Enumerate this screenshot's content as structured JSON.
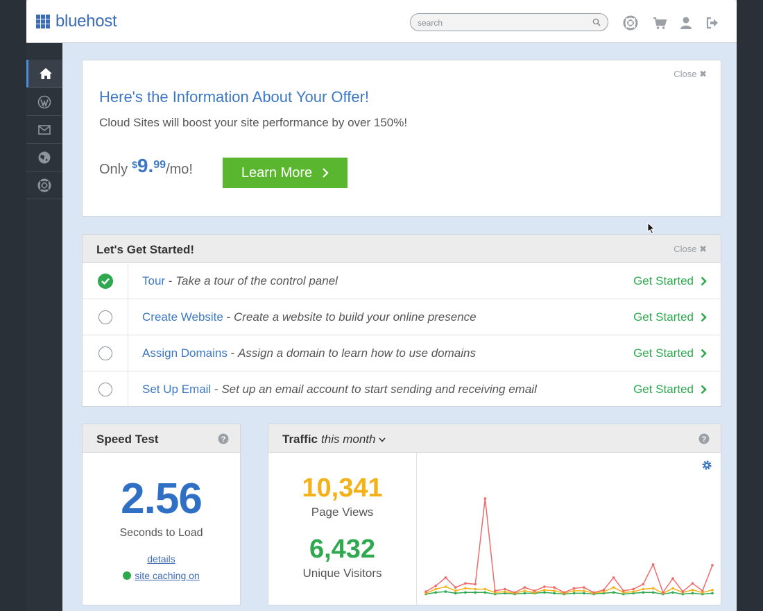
{
  "brand": {
    "name": "bluehost",
    "color": "#3d6ab7"
  },
  "search": {
    "placeholder": "search",
    "value": ""
  },
  "topbar_icons": [
    "help-lifebuoy-icon",
    "cart-icon",
    "user-icon",
    "logout-icon"
  ],
  "sidebar": {
    "items": [
      {
        "icon": "home-icon",
        "active": true
      },
      {
        "icon": "wordpress-icon",
        "active": false
      },
      {
        "icon": "mail-icon",
        "active": false
      },
      {
        "icon": "globe-icon",
        "active": false
      },
      {
        "icon": "support-lifebuoy-icon",
        "active": false
      }
    ]
  },
  "offer": {
    "close_label": "Close",
    "title": "Here's the Information About Your Offer!",
    "subtitle": "Cloud Sites will boost your site performance by over 150%!",
    "price_prefix": "Only",
    "currency": "$",
    "price_dollars": "9.",
    "price_cents": "99",
    "price_suffix": "/mo!",
    "cta_label": "Learn More",
    "cta_color": "#5bb62f"
  },
  "getting_started": {
    "title": "Let's Get Started!",
    "close_label": "Close",
    "tasks": [
      {
        "name": "Tour",
        "separator": " - ",
        "description": "Take a tour of the control panel",
        "done": true,
        "action": "Get Started"
      },
      {
        "name": "Create Website",
        "separator": " - ",
        "description": "Create a website to build your online presence",
        "done": false,
        "action": "Get Started"
      },
      {
        "name": "Assign Domains",
        "separator": " - ",
        "description": "Assign a domain to learn how to use domains",
        "done": false,
        "action": "Get Started"
      },
      {
        "name": "Set Up Email",
        "separator": " - ",
        "description": "Set up an email account to start sending and receiving email",
        "done": false,
        "action": "Get Started"
      }
    ]
  },
  "speed_test": {
    "title": "Speed Test",
    "value": "2.56",
    "label": "Seconds to Load",
    "details_link": "details",
    "caching_link": "site caching on",
    "caching_status_color": "#2fa84f"
  },
  "traffic": {
    "title": "Traffic",
    "period": "this month",
    "page_views": "10,341",
    "page_views_label": "Page Views",
    "page_views_color": "#f3b21a",
    "unique_visitors": "6,432",
    "unique_visitors_label": "Unique Visitors",
    "unique_visitors_color": "#2fa84f"
  },
  "chart_data": {
    "type": "line",
    "x": [
      1,
      2,
      3,
      4,
      5,
      6,
      7,
      8,
      9,
      10,
      11,
      12,
      13,
      14,
      15,
      16,
      17,
      18,
      19,
      20,
      21,
      22,
      23,
      24,
      25,
      26,
      27,
      28,
      29,
      30
    ],
    "series": [
      {
        "color": "#ef6b6b",
        "values": [
          0.5,
          1.2,
          2.2,
          1.0,
          1.5,
          1.4,
          11.8,
          0.6,
          0.8,
          0.4,
          1.0,
          0.6,
          1.1,
          1.0,
          0.4,
          0.9,
          1.0,
          0.4,
          0.7,
          2.2,
          0.6,
          0.8,
          1.4,
          3.8,
          0.4,
          2.1,
          0.5,
          1.5,
          0.6,
          3.7
        ]
      },
      {
        "color": "#f3b21a",
        "values": [
          0.3,
          0.8,
          1.1,
          0.6,
          0.9,
          0.8,
          0.8,
          0.4,
          0.5,
          0.3,
          0.6,
          0.4,
          0.7,
          0.6,
          0.3,
          0.6,
          0.6,
          0.3,
          0.5,
          1.0,
          0.4,
          0.5,
          0.8,
          0.9,
          0.3,
          0.9,
          0.4,
          0.7,
          0.4,
          0.7
        ]
      },
      {
        "color": "#2fa84f",
        "values": [
          0.2,
          0.4,
          0.5,
          0.3,
          0.4,
          0.4,
          0.4,
          0.2,
          0.3,
          0.2,
          0.3,
          0.3,
          0.4,
          0.3,
          0.2,
          0.3,
          0.3,
          0.2,
          0.3,
          0.4,
          0.2,
          0.3,
          0.4,
          0.4,
          0.2,
          0.4,
          0.2,
          0.3,
          0.2,
          0.3
        ]
      }
    ],
    "ylim": [
      0,
      14
    ],
    "grid": false,
    "legend": "none"
  }
}
